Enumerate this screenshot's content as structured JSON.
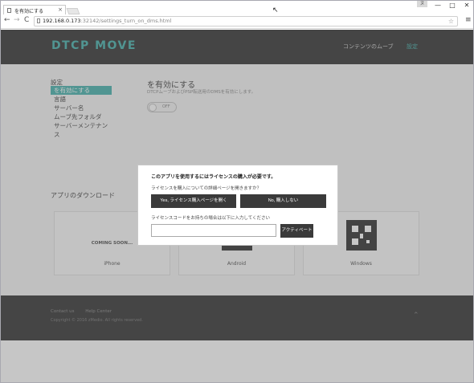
{
  "browser": {
    "tab_title": "を有効にする",
    "tab_close": "×",
    "url_host": "192.168.0.173",
    "url_path": ":32142/settings_turn_on_dms.html",
    "back": "←",
    "forward": "→",
    "reload": "C",
    "star": "☆",
    "menu": "≡",
    "user_box": "ヌ",
    "win_min": "—",
    "win_max": "□",
    "win_close": "✕",
    "cursor": "↖"
  },
  "header": {
    "logo": "DTCP MOVE",
    "nav": [
      "コンテンツのムーブ",
      "設定"
    ],
    "accent": "#2aa7a0"
  },
  "sidebar": {
    "title": "設定",
    "items": [
      {
        "label": "を有効にする",
        "selected": true
      },
      {
        "label": "言語",
        "selected": false
      },
      {
        "label": "サーバー名",
        "selected": false
      },
      {
        "label": "ムーブ先フォルダ",
        "selected": false
      },
      {
        "label": "サーバーメンテナンス",
        "selected": false
      }
    ]
  },
  "main": {
    "title": "を有効にする",
    "description": "DTCPムーブおよびPSP転送用のDMSを有効にします。",
    "toggle_label": "OFF"
  },
  "downloads": {
    "title": "アプリのダウンロード",
    "cards": [
      {
        "name": "iPhone",
        "status": "COMING SOON..."
      },
      {
        "name": "Android",
        "status": ""
      },
      {
        "name": "Windows",
        "status": ""
      }
    ]
  },
  "footer": {
    "links": [
      "Contact us",
      "Help Center"
    ],
    "copyright": "Copyright © 2016 zMedio. All rights reserved.",
    "to_top": "⌃"
  },
  "modal": {
    "title": "このアプリを使用するにはライセンスの購入が必要です。",
    "question": "ライセンスを購入についての詳細ページを開きますか？",
    "yes_button": "Yes, ライセンス購入ページを開く",
    "no_button": "No, 購入しない",
    "license_prompt": "ライセンスコードをお持ちの場合は以下に入力してください",
    "license_value": "",
    "activate_button": "アクティベート"
  }
}
